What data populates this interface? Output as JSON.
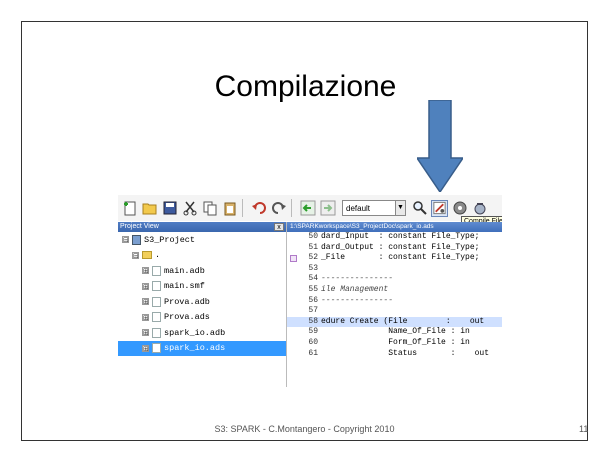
{
  "slide": {
    "title": "Compilazione",
    "footer": "S3: SPARK - C.Montangero - Copyright 2010",
    "page_number": "11"
  },
  "colors": {
    "arrow_fill": "#4f81bd",
    "arrow_stroke": "#385d8a",
    "panel_header": "#3a67ae",
    "selection": "#3399ff"
  },
  "toolbar": {
    "icons": [
      "new-file-icon",
      "open-folder-icon",
      "save-icon",
      "cut-icon",
      "copy-icon",
      "paste-icon",
      "undo-icon",
      "redo-icon",
      "back-icon",
      "forward-icon",
      "search-icon",
      "compile-icon",
      "build-icon",
      "clean-icon"
    ],
    "config_value": "default",
    "tooltip": "Compile File"
  },
  "project_view": {
    "header": "Project View",
    "close_label": "x",
    "items": [
      {
        "label": "S3_Project",
        "expander": "⊟",
        "kind": "project"
      },
      {
        "label": ".",
        "expander": "⊟",
        "kind": "folder"
      },
      {
        "label": "main.adb",
        "expander": "⊞",
        "kind": "file"
      },
      {
        "label": "main.smf",
        "expander": "⊞",
        "kind": "file"
      },
      {
        "label": "Prova.adb",
        "expander": "⊞",
        "kind": "file"
      },
      {
        "label": "Prova.ads",
        "expander": "⊞",
        "kind": "file"
      },
      {
        "label": "spark_io.adb",
        "expander": "⊞",
        "kind": "file"
      },
      {
        "label": "spark_io.ads",
        "expander": "⊞",
        "kind": "file",
        "selected": true
      }
    ]
  },
  "editor": {
    "tab_path": "1:\\SPARKworkspace\\S3_ProjectDoc\\spark_io.ads",
    "lines": [
      {
        "num": "50",
        "text": "dard_Input  : constant File_Type;"
      },
      {
        "num": "51",
        "text": "dard_Output : constant File_Type;"
      },
      {
        "num": "52",
        "text": "_File       : constant File_Type;"
      },
      {
        "num": "53",
        "text": ""
      },
      {
        "num": "54",
        "text": "---------------"
      },
      {
        "num": "55",
        "text": "ile Management"
      },
      {
        "num": "56",
        "text": "---------------"
      },
      {
        "num": "57",
        "text": ""
      },
      {
        "num": "58",
        "text": "edure Create (File        :    out"
      },
      {
        "num": "59",
        "text": "              Name_Of_File : in"
      },
      {
        "num": "60",
        "text": "              Form_Of_File : in"
      },
      {
        "num": "61",
        "text": "              Status       :    out"
      }
    ]
  }
}
